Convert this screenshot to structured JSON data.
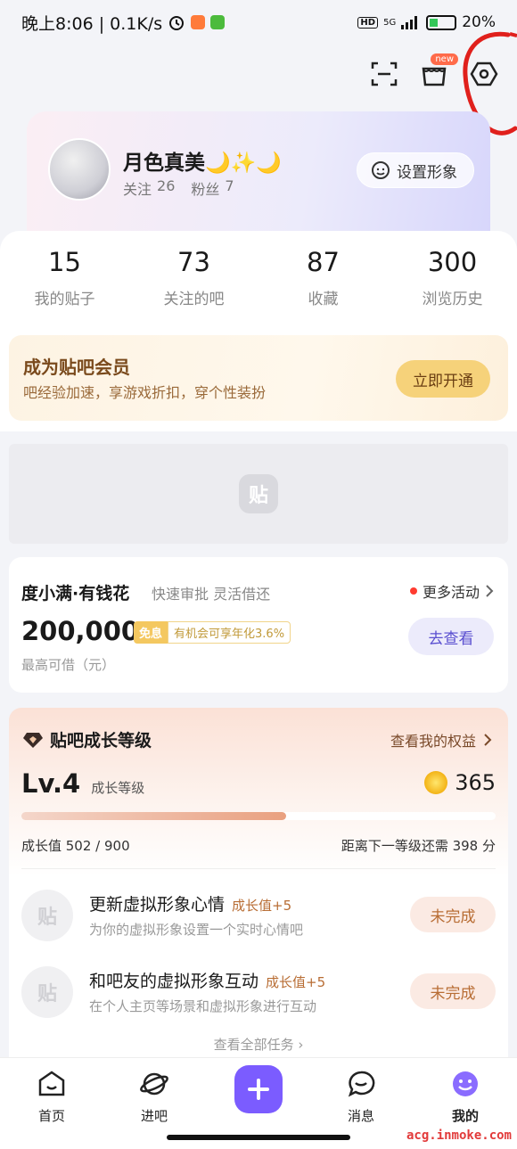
{
  "status_bar": {
    "time_net": "晚上8:06 | 0.1K/s",
    "signal_text": "5G",
    "hd_text": "HD",
    "battery_text": "20%"
  },
  "top_actions": {
    "new_badge": "new"
  },
  "profile": {
    "name": "月色真美🌙✨🌙",
    "follow_label": "关注",
    "follow_count": "26",
    "fans_label": "粉丝",
    "fans_count": "7",
    "set_avatar_label": "设置形象"
  },
  "stats": [
    {
      "num": "15",
      "label": "我的贴子"
    },
    {
      "num": "73",
      "label": "关注的吧"
    },
    {
      "num": "87",
      "label": "收藏"
    },
    {
      "num": "300",
      "label": "浏览历史"
    }
  ],
  "vip": {
    "title": "成为贴吧会员",
    "subtitle": "吧经验加速，享游戏折扣，穿个性装扮",
    "button": "立即开通"
  },
  "ad": {
    "logo_text": "贴"
  },
  "loan": {
    "brand": "度小满·有钱花",
    "tagline": "快速审批 灵活借还",
    "more": "更多活动",
    "amount": "200,000",
    "free_tag": "免息",
    "rate_tag": "有机会可享年化3.6%",
    "caption": "最高可借（元）",
    "button": "去查看"
  },
  "growth": {
    "title": "贴吧成长等级",
    "rights": "查看我的权益",
    "level": "Lv.4",
    "level_label": "成长等级",
    "coins": "365",
    "progress": 0.558,
    "progress_left": "成长值 502 / 900",
    "progress_right": "距离下一等级还需 398 分",
    "tasks": [
      {
        "logo": "贴",
        "title": "更新虚拟形象心情",
        "reward": "成长值+5",
        "sub": "为你的虚拟形象设置一个实时心情吧",
        "button": "未完成"
      },
      {
        "logo": "贴",
        "title": "和吧友的虚拟形象互动",
        "reward": "成长值+5",
        "sub": "在个人主页等场景和虚拟形象进行互动",
        "button": "未完成"
      }
    ],
    "view_all": "查看全部任务 ›"
  },
  "tabs": [
    {
      "label": "首页",
      "icon": "home-icon"
    },
    {
      "label": "进吧",
      "icon": "planet-icon"
    },
    {
      "label": "消息",
      "icon": "message-icon"
    },
    {
      "label": "我的",
      "icon": "profile-icon"
    }
  ],
  "watermark": "acg.inmoke.com",
  "colors": {
    "accent": "#7b5cff",
    "vip_button": "#f6d27a",
    "reward": "#b86d34"
  }
}
